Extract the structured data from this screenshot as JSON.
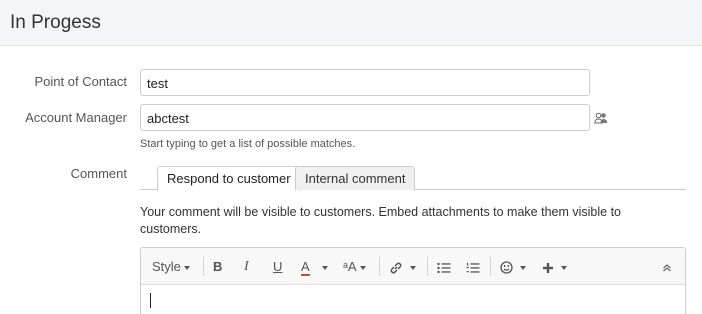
{
  "header": {
    "title": "In Progess"
  },
  "form": {
    "poc_label": "Point of Contact",
    "poc_value": "test",
    "am_label": "Account Manager",
    "am_value": "abctest",
    "am_hint": "Start typing to get a list of possible matches.",
    "comment_label": "Comment"
  },
  "tabs": [
    {
      "label": "Respond to customer",
      "active": true
    },
    {
      "label": "Internal comment",
      "active": false
    }
  ],
  "notice": "Your comment will be visible to customers. Embed attachments to make them visible to customers.",
  "toolbar": {
    "style_label": "Style",
    "bold": "B",
    "italic": "I",
    "underline": "U",
    "text_color": "A",
    "text_size": "ᵃA"
  },
  "colors": {
    "header_bg": "#f4f5f7",
    "text_color_underline": "#d04437"
  },
  "icons": [
    "people-picker-icon",
    "link-icon",
    "bullet-list-icon",
    "numbered-list-icon",
    "emoticon-icon",
    "insert-plus-icon",
    "collapse-toolbar-icon"
  ]
}
